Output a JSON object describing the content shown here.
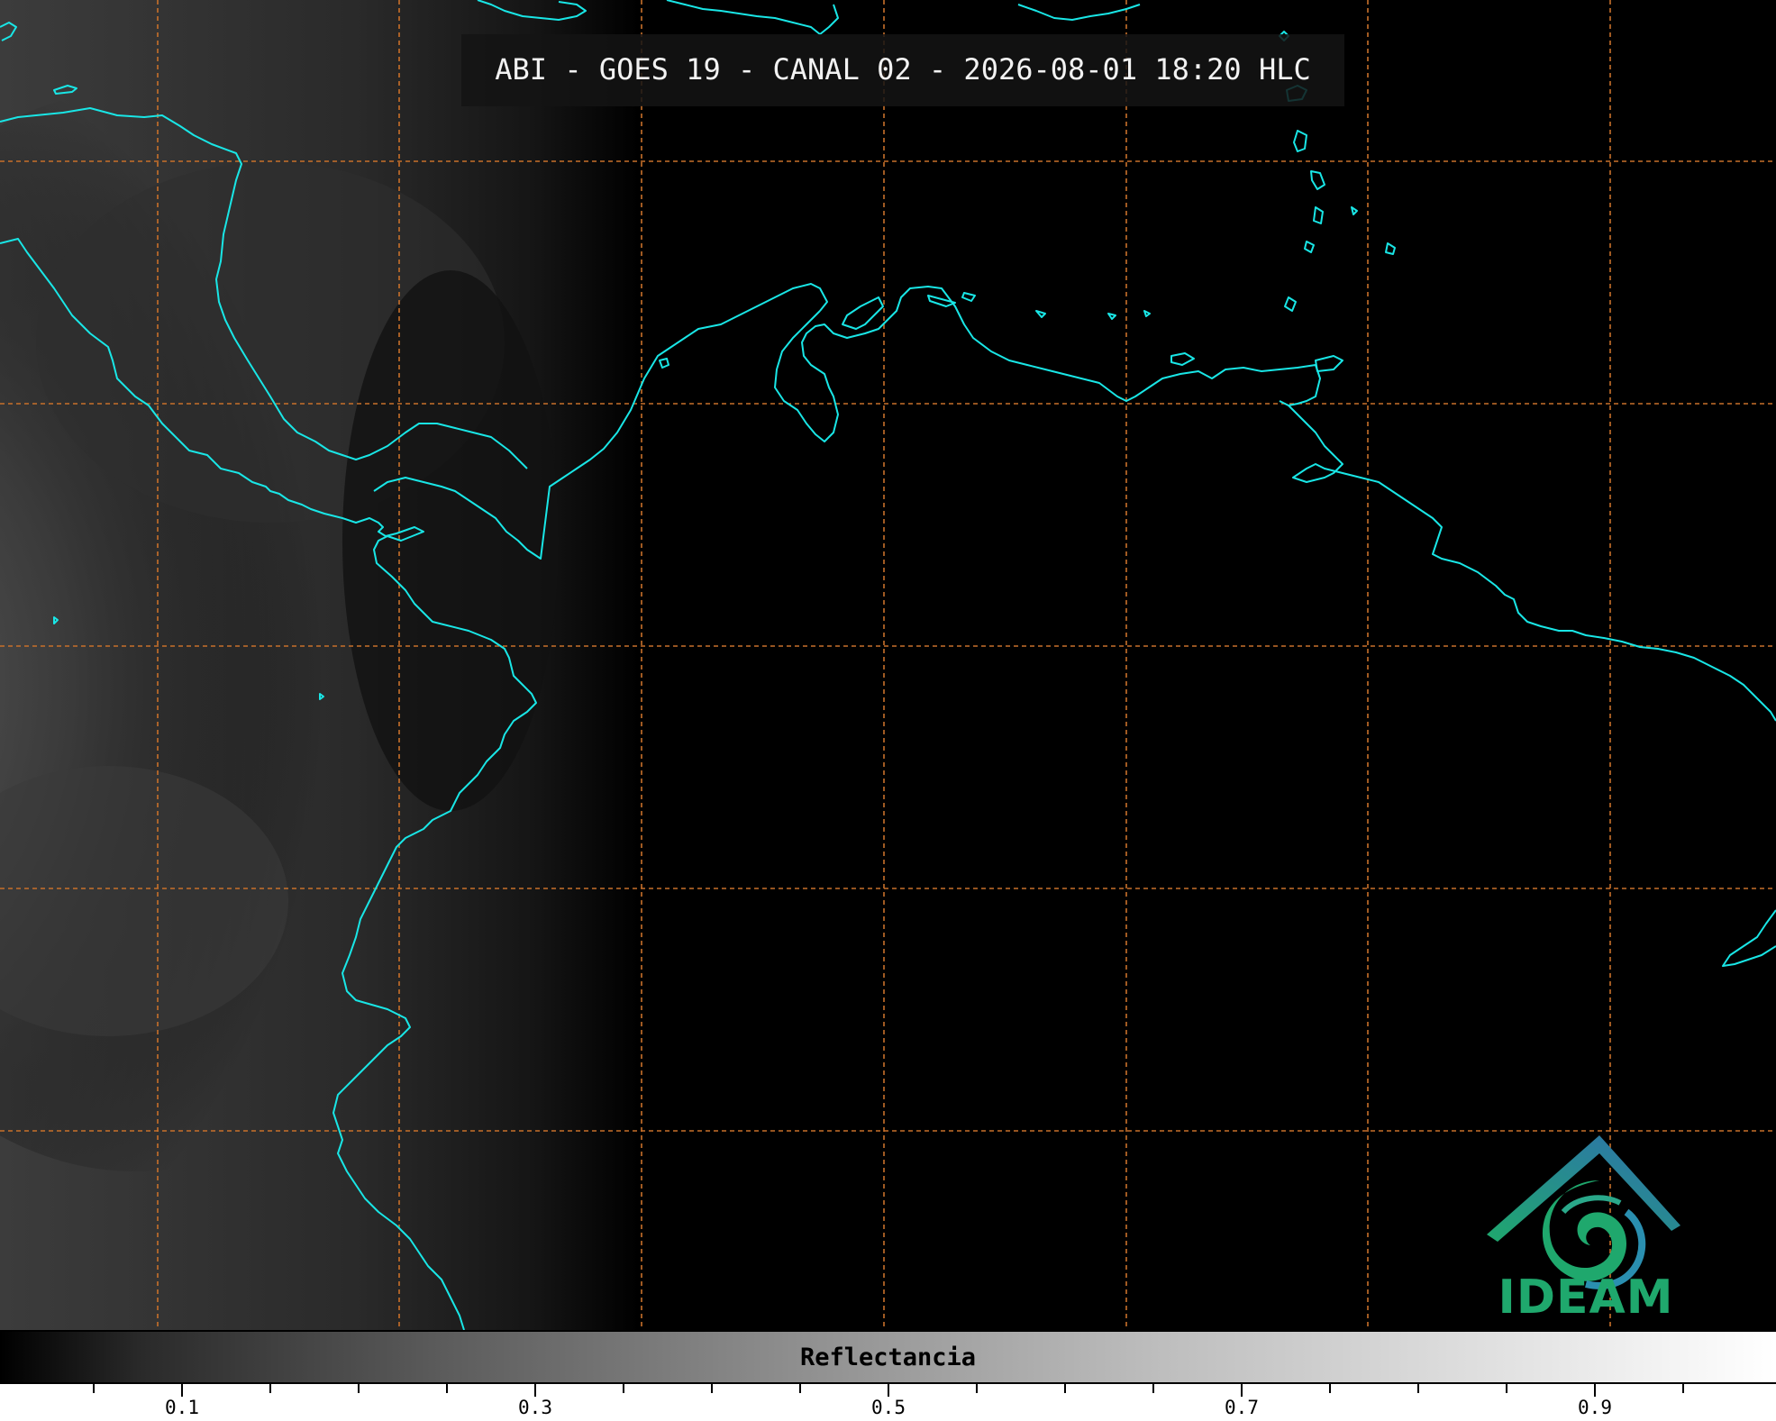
{
  "title": "ABI - GOES 19 - CANAL 02 - 2026-08-01 18:20 HLC",
  "colors": {
    "coastline": "#19e6e6",
    "grid": "#c8702a",
    "background": "#000000",
    "logo_green": "#1fa86d",
    "logo_blue": "#2f6fb0"
  },
  "colorbar": {
    "label": "Reflectancia",
    "ticks": [
      {
        "value": "0.1"
      },
      {
        "value": "0.3"
      },
      {
        "value": "0.5"
      },
      {
        "value": "0.7"
      },
      {
        "value": "0.9"
      }
    ]
  },
  "logo": {
    "text": "IDEAM"
  },
  "icons": [
    "ideam-logo-icon"
  ]
}
